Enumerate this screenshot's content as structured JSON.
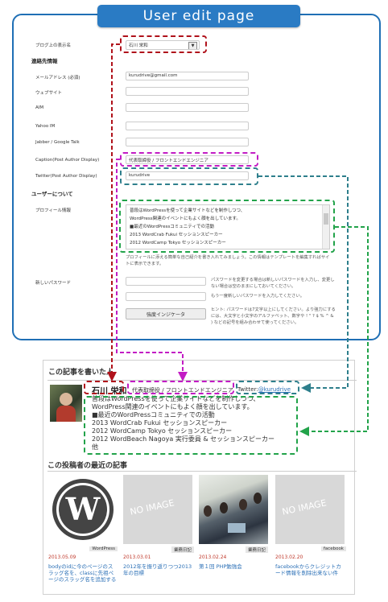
{
  "header": {
    "title": "User edit page"
  },
  "form": {
    "display_name_label": "ブログ上の表示名",
    "display_name_value": "石川 栄和",
    "contact_section": "連絡先情報",
    "email_label": "メールアドレス (必須)",
    "email_value": "kurudrive@gmail.com",
    "website_label": "ウェブサイト",
    "aim_label": "AIM",
    "yahoo_label": "Yahoo IM",
    "jabber_label": "Jabber / Google Talk",
    "caption_label": "Caption(Post Author Display)",
    "caption_value": "代表取締役 / フロントエンドエンジニア",
    "twitter_label": "Twitter(Post Author Display)",
    "twitter_value": "kurudrive",
    "about_section": "ユーザーについて",
    "profile_label": "プロフィール情報",
    "profile_lines": [
      "普段はWordPressを使って企業サイトなどを制作しつつ、",
      "WordPress関連のイベントにもよく顔を出しています。",
      "■最近のWordPressコミュニティでの活動",
      "2013 WordCrab Fukui セッションスピーカー",
      "2012 WordCamp Tokyo セッションスピーカー"
    ],
    "profile_desc": "プロフィールに添える簡単な自己紹介を書き入れてみましょう。この情報はテンプレートを編集すればサイトに表示できます。",
    "password_label": "新しいパスワード",
    "password_desc1": "パスワードを変更する場合は新しいパスワードを入力し、変更しない場合は空のままにしておいてください。",
    "password_desc2": "もう一度新しいパスワードを入力してください。",
    "strength_button": "強度インジケータ",
    "hint": "ヒント: パスワードは7文字以上にしてください。より強力にするには、大文字と小文字のアルファベット、数字や ! \" ? $ % ^ & ) などの記号を組み合わせて使ってください。"
  },
  "author_box": {
    "heading": "この記事を書いた人",
    "name": "石川 栄和",
    "caption": "代表取締役 / フロントエンドエンジニア",
    "twitter_prefix": "Twitter:",
    "twitter_handle": "@kurudrive",
    "bio_lines": [
      "普段はWordPressを使って企業サイトなどを制作しつつ、",
      "WordPress関連のイベントにもよく顔を出しています。",
      "■最近のWordPressコミュニティでの活動",
      "2013 WordCrab Fukui セッションスピーカー",
      "2012 WordCamp Tokyo セッションスピーカー",
      "2012 WordBeach Nagoya 実行委員 & セッションスピーカー",
      "他"
    ]
  },
  "recent_posts": {
    "heading": "この投稿者の最近の記事",
    "items": [
      {
        "image": "wordpress-logo",
        "date": "2013.05.09",
        "category": "WordPress",
        "title": "bodyのidに今のページのスラッグ名を、classに先祖ページのスラッグ名を追加する"
      },
      {
        "image": "no-image",
        "image_text": "NO IMAGE",
        "date": "2013.03.01",
        "category": "業務日記",
        "title": "2012年を振り返りつつ2013年の目標"
      },
      {
        "image": "photo",
        "date": "2013.02.24",
        "category": "業務日記",
        "title": "第１回 PHP勉強会"
      },
      {
        "image": "no-image",
        "image_text": "NO IMAGE",
        "date": "2013.02.20",
        "category": "facebook",
        "title": "facebookからクレジットカード情報を削除出来ない件"
      }
    ]
  },
  "colors": {
    "accent": "#2a7bc4",
    "red": "#b0121b",
    "magenta": "#c21cc4",
    "teal": "#2e7f8c",
    "green": "#22a34a"
  }
}
